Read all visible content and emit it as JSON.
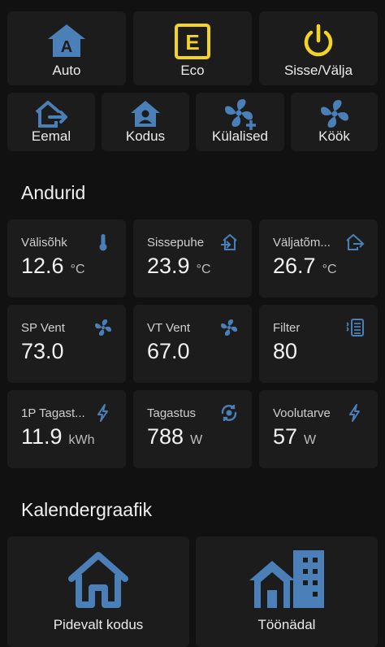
{
  "colors": {
    "background": "#111111",
    "card": "#1c1c1c",
    "accent_blue": "#4a7fb8",
    "accent_yellow": "#f2d326"
  },
  "modes_row1": [
    {
      "label": "Auto",
      "icon": "home-auto-icon",
      "color": "#4a7fb8"
    },
    {
      "label": "Eco",
      "icon": "eco-letter-e-icon",
      "color": "#f2d326"
    },
    {
      "label": "Sisse/Välja",
      "icon": "power-icon",
      "color": "#f2d326"
    }
  ],
  "modes_row2": [
    {
      "label": "Eemal",
      "icon": "home-export-icon"
    },
    {
      "label": "Kodus",
      "icon": "home-account-icon"
    },
    {
      "label": "Külalised",
      "icon": "fan-plus-icon"
    },
    {
      "label": "Köök",
      "icon": "fan-icon"
    }
  ],
  "sensors_section": {
    "title": "Andurid"
  },
  "sensors": [
    {
      "name": "Välisõhk",
      "value": "12.6",
      "unit": "°C",
      "icon": "thermometer-icon"
    },
    {
      "name": "Sissepuhe",
      "value": "23.9",
      "unit": "°C",
      "icon": "home-import-icon"
    },
    {
      "name": "Väljatõm...",
      "value": "26.7",
      "unit": "°C",
      "icon": "home-export-icon"
    },
    {
      "name": "SP Vent",
      "value": "73.0",
      "unit": "",
      "icon": "fan-icon"
    },
    {
      "name": "VT Vent",
      "value": "67.0",
      "unit": "",
      "icon": "fan-icon"
    },
    {
      "name": "Filter",
      "value": "80",
      "unit": "",
      "icon": "air-filter-icon"
    },
    {
      "name": "1P Tagast...",
      "value": "11.9",
      "unit": "kWh",
      "icon": "lightning-icon"
    },
    {
      "name": "Tagastus",
      "value": "788",
      "unit": "W",
      "icon": "heat-recovery-icon"
    },
    {
      "name": "Voolutarve",
      "value": "57",
      "unit": "W",
      "icon": "lightning-icon"
    }
  ],
  "calendar_section": {
    "title": "Kalendergraafik"
  },
  "calendar": [
    {
      "label": "Pidevalt kodus",
      "icon": "home-icon"
    },
    {
      "label": "Töönädal",
      "icon": "home-city-icon"
    }
  ]
}
